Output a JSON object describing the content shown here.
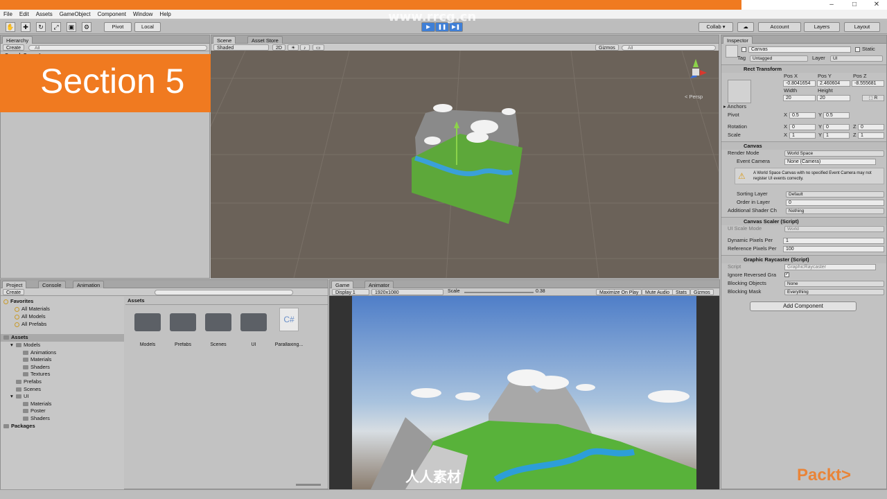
{
  "window": {
    "min": "–",
    "max": "□",
    "close": "✕"
  },
  "menu": [
    "File",
    "Edit",
    "Assets",
    "GameObject",
    "Component",
    "Window",
    "Help"
  ],
  "toolbar": {
    "tools": [
      "✋",
      "✚",
      "↻",
      "⤢",
      "▣",
      "⚙"
    ],
    "pivot": "Pivot",
    "local": "Local",
    "play": "▶",
    "pause": "❚❚",
    "step": "▶❚",
    "collab": "Collab ▾",
    "cloud": "☁",
    "account": "Account",
    "layers": "Layers",
    "layout": "Layout"
  },
  "overlay": {
    "section": "Section 5",
    "watermark": "www.rrcg.cn",
    "publisher": "Packt>",
    "bottom_logo": "人人素材"
  },
  "hierarchy": {
    "tab": "Hierarchy",
    "create": "Create",
    "search": "All",
    "scene": "SampleScene*"
  },
  "scene": {
    "tabs": [
      "Scene",
      "Asset Store"
    ],
    "shading": "Shaded",
    "mode2d": "2D",
    "gizmos": "Gizmos",
    "search": "All",
    "persp": "< Persp"
  },
  "project": {
    "tabs": [
      "Project",
      "Console",
      "Animation"
    ],
    "create": "Create",
    "favorites": "Favorites",
    "favorite_items": [
      "All Materials",
      "All Models",
      "All Prefabs"
    ],
    "assets_root": "Assets",
    "tree": [
      {
        "label": "Models",
        "indent": 1,
        "expanded": true
      },
      {
        "label": "Animations",
        "indent": 2
      },
      {
        "label": "Materials",
        "indent": 2
      },
      {
        "label": "Shaders",
        "indent": 2
      },
      {
        "label": "Textures",
        "indent": 2
      },
      {
        "label": "Prefabs",
        "indent": 1
      },
      {
        "label": "Scenes",
        "indent": 1
      },
      {
        "label": "UI",
        "indent": 1,
        "expanded": true
      },
      {
        "label": "Materials",
        "indent": 2
      },
      {
        "label": "Poster",
        "indent": 2
      },
      {
        "label": "Shaders",
        "indent": 2
      }
    ],
    "packages": "Packages",
    "breadcrumb": "Assets",
    "grid": [
      "Models",
      "Prefabs",
      "Scenes",
      "UI",
      "Parallaxing..."
    ],
    "script_glyph": "C#"
  },
  "game": {
    "tabs": [
      "Game",
      "Animator"
    ],
    "display": "Display 1",
    "resolution": "1920x1080",
    "scale_label": "Scale",
    "scale_value": "0.38",
    "buttons": [
      "Maximize On Play",
      "Mute Audio",
      "Stats",
      "Gizmos"
    ]
  },
  "inspector": {
    "tab": "Inspector",
    "object_name": "Canvas",
    "static": "Static",
    "tag_label": "Tag",
    "tag": "Untagged",
    "layer_label": "Layer",
    "layer": "UI",
    "rect": {
      "title": "Rect Transform",
      "posx_label": "Pos X",
      "posy_label": "Pos Y",
      "posz_label": "Pos Z",
      "posx": "-0.8041654",
      "posy": "2.460604",
      "posz": "-8.555681",
      "width_label": "Width",
      "height_label": "Height",
      "width": "20",
      "height": "20",
      "anchors": "Anchors",
      "pivot_label": "Pivot",
      "pivot_x": "0.5",
      "pivot_y": "0.5",
      "rotation_label": "Rotation",
      "rot_x": "0",
      "rot_y": "0",
      "rot_z": "0",
      "scale_label": "Scale",
      "scale_x": "1",
      "scale_y": "1",
      "scale_z": "1",
      "x": "X",
      "y": "Y",
      "z": "Z"
    },
    "canvas": {
      "title": "Canvas",
      "render_mode_label": "Render Mode",
      "render_mode": "World Space",
      "event_camera_label": "Event Camera",
      "event_camera": "None (Camera)",
      "warning": "A World Space Canvas with no specified Event Camera may not register UI events correctly.",
      "sorting_layer_label": "Sorting Layer",
      "sorting_layer": "Default",
      "order_label": "Order in Layer",
      "order": "0",
      "shader_label": "Additional Shader Ch",
      "shader": "Nothing"
    },
    "scaler": {
      "title": "Canvas Scaler (Script)",
      "mode_label": "UI Scale Mode",
      "mode": "World",
      "dynamic_label": "Dynamic Pixels Per",
      "dynamic": "1",
      "reference_label": "Reference Pixels Per",
      "reference": "100"
    },
    "raycaster": {
      "title": "Graphic Raycaster (Script)",
      "script_label": "Script",
      "script": "GraphicRaycaster",
      "ignore_label": "Ignore Reversed Gra",
      "blocking_objects_label": "Blocking Objects",
      "blocking_objects": "None",
      "blocking_mask_label": "Blocking Mask",
      "blocking_mask": "Everything"
    },
    "add_component": "Add Component"
  },
  "colors": {
    "section_bg": "#f07a20",
    "accent": "#3f7fd6"
  }
}
